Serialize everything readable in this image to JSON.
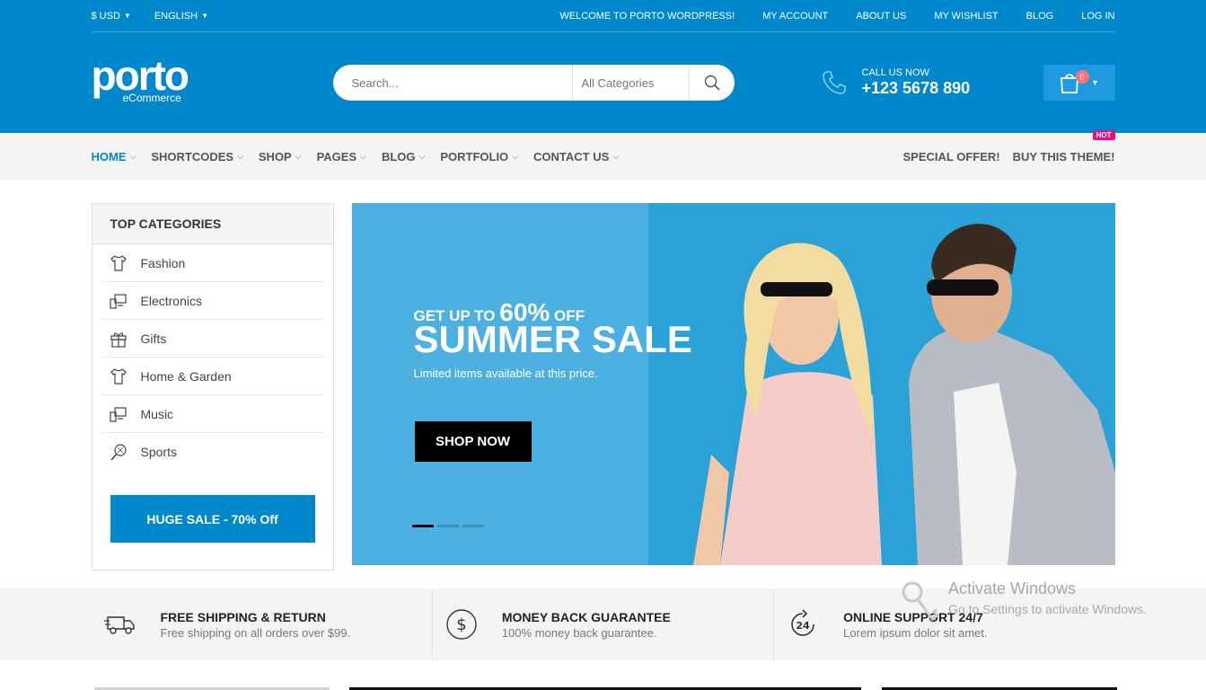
{
  "topbar": {
    "currency": "$ USD",
    "language": "ENGLISH",
    "links": [
      "WELCOME TO PORTO WORDPRESS!",
      "MY ACCOUNT",
      "ABOUT US",
      "MY WISHLIST",
      "BLOG",
      "LOG IN"
    ]
  },
  "header": {
    "brand": "porto",
    "brand_sub": "eCommerce",
    "search_placeholder": "Search...",
    "category_select": "All Categories",
    "call_label": "CALL US NOW",
    "call_number": "+123 5678 890",
    "cart_count": "0"
  },
  "nav": {
    "items": [
      "HOME",
      "SHORTCODES",
      "SHOP",
      "PAGES",
      "BLOG",
      "PORTFOLIO",
      "CONTACT US"
    ],
    "special_offer": "SPECIAL OFFER!",
    "buy_theme": "BUY THIS THEME!",
    "hot_badge": "HOT"
  },
  "sidebar": {
    "title": "TOP CATEGORIES",
    "categories": [
      {
        "label": "Fashion",
        "icon": "shirt-icon"
      },
      {
        "label": "Electronics",
        "icon": "devices-icon"
      },
      {
        "label": "Gifts",
        "icon": "gift-icon"
      },
      {
        "label": "Home & Garden",
        "icon": "home-garden-icon"
      },
      {
        "label": "Music",
        "icon": "devices-icon"
      },
      {
        "label": "Sports",
        "icon": "racket-icon"
      }
    ],
    "sale_button": "HUGE SALE - 70% Off"
  },
  "slider": {
    "pre_text": "GET UP TO",
    "pct": "60%",
    "off": "OFF",
    "title": "SUMMER SALE",
    "subtitle": "Limited items available at this price.",
    "button": "SHOP NOW"
  },
  "features": [
    {
      "title": "FREE SHIPPING & RETURN",
      "sub": "Free shipping on all orders over $99.",
      "icon": "truck-icon"
    },
    {
      "title": "MONEY BACK GUARANTEE",
      "sub": "100% money back guarantee.",
      "icon": "dollar-icon"
    },
    {
      "title": "ONLINE SUPPORT 24/7",
      "sub": "Lorem ipsum dolor sit amet.",
      "icon": "support-24-icon"
    }
  ],
  "watermark": {
    "title": "Activate Windows",
    "sub": "Go to Settings to activate Windows."
  },
  "colors": {
    "primary": "#0088cc",
    "nav_bg": "#f4f4f4",
    "hot": "#e0157b",
    "slider_bg": "#4cb0e0"
  }
}
